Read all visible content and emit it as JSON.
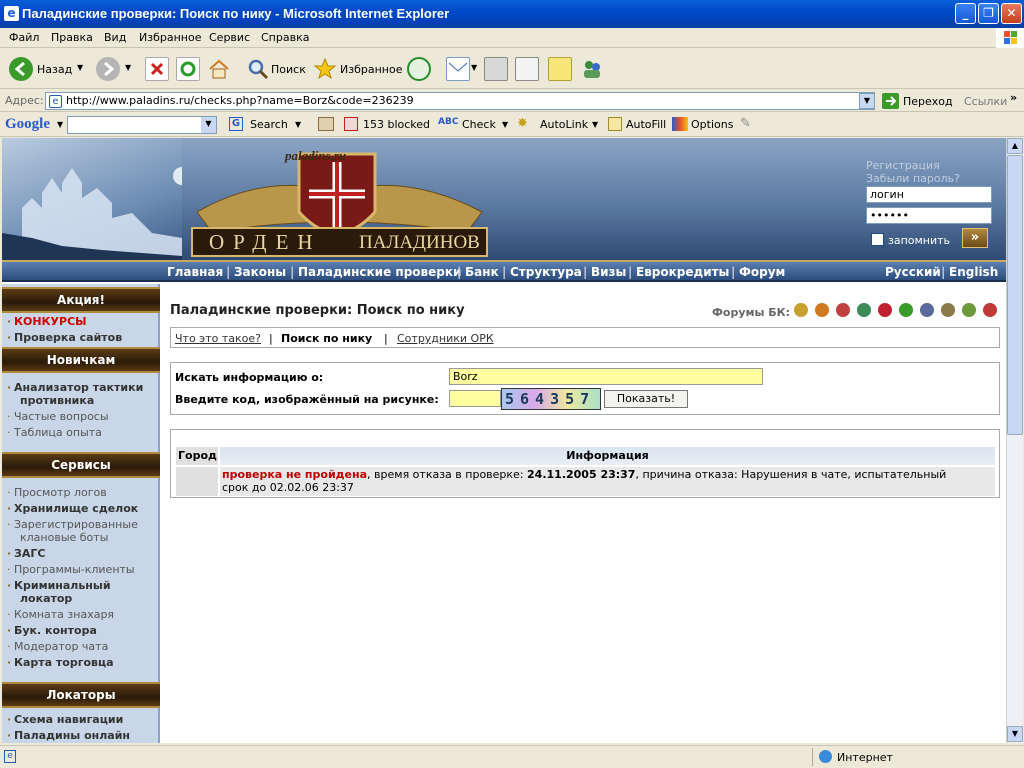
{
  "window": {
    "title": "Паладинские проверки: Поиск по нику - Microsoft Internet Explorer"
  },
  "menu": [
    "Файл",
    "Правка",
    "Вид",
    "Избранное",
    "Сервис",
    "Справка"
  ],
  "toolbar": {
    "back": "Назад",
    "search": "Поиск",
    "favorites": "Избранное"
  },
  "address": {
    "label": "Адрес:",
    "url": "http://www.paladins.ru/checks.php?name=Borz&code=236239",
    "go": "Переход",
    "links": "Ссылки"
  },
  "google": {
    "brand": "Google",
    "search": "Search",
    "blocked": "153 blocked",
    "check": "Check",
    "autolink": "AutoLink",
    "autofill": "AutoFill",
    "options": "Options"
  },
  "header": {
    "site_logo": "paladins.ru",
    "banner_left": "ОРДЕН",
    "banner_right": "ПАЛАДИНОВ",
    "register": "Регистрация",
    "forgot": "Забыли пароль?",
    "login_value": "логин",
    "password_value": "••••••",
    "remember": "запомнить",
    "go": "»"
  },
  "nav": {
    "items": [
      "Главная",
      "Законы",
      "Паладинские проверки",
      "Банк",
      "Структура",
      "Визы",
      "Еврокредиты",
      "Форум"
    ],
    "lang_ru": "Русский",
    "lang_en": "English"
  },
  "sidebar": {
    "action_head": "Акция!",
    "action_items": [
      "КОНКУРСЫ",
      "Проверка сайтов"
    ],
    "newbie_head": "Новичкам",
    "newbie_items": [
      "Анализатор тактики",
      "противника",
      "Частые вопросы",
      "Таблица опыта"
    ],
    "services_head": "Сервисы",
    "services_items": [
      "Просмотр логов",
      "Хранилище сделок",
      "Зарегистрированные",
      "клановые боты",
      "ЗАГС",
      "Программы-клиенты",
      "Криминальный",
      "локатор",
      "Комната знахаря",
      "Бук. контора",
      "Модератор чата",
      "Карта торговца"
    ],
    "locators_head": "Локаторы",
    "locators_items": [
      "Схема навигации",
      "Паладины онлайн"
    ]
  },
  "content": {
    "page_title": "Паладинские проверки: Поиск по нику",
    "forums_label": "Форумы БК:",
    "tabs": [
      "Что это такое?",
      "Поиск по нику",
      "Сотрудники ОРК"
    ],
    "search_label": "Искать информацию о:",
    "search_value": "Borz",
    "code_label": "Введите код, изображённый на рисунке:",
    "captcha": "564357",
    "show_button": "Показать!",
    "table_headers": [
      "Город",
      "Информация"
    ],
    "result_status": "проверка не пройдена",
    "result_rest1": ", время отказа в проверке: ",
    "result_date": "24.11.2005 23:37",
    "result_rest2": ", причина отказа: Нарушения в чате, испытательный",
    "result_line2": "срок до 02.02.06 23:37"
  },
  "statusbar": {
    "zone": "Интернет"
  }
}
